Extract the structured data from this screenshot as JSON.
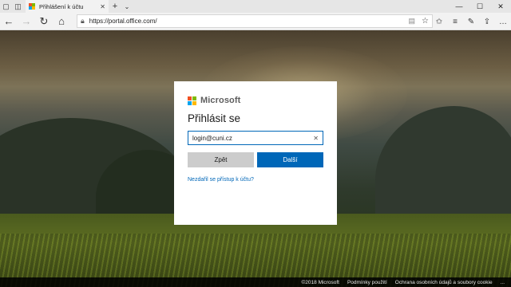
{
  "browser": {
    "tab_title": "Přihlášení k účtu",
    "tab_close": "✕",
    "new_tab": "+",
    "tab_menu": "⌄",
    "url": "https://portal.office.com/",
    "window_controls": {
      "minimize": "—",
      "maximize": "☐",
      "close": "✕"
    },
    "nav": {
      "back": "←",
      "forward": "→",
      "refresh": "↻",
      "home": "⌂"
    },
    "toolbar": {
      "favorites": "☆",
      "reading": "≡",
      "pen": "✎",
      "share": "⇪",
      "more": "…"
    }
  },
  "dialog": {
    "brand": "Microsoft",
    "title": "Přihlásit se",
    "email_value": "login@cuni.cz",
    "clear_glyph": "✕",
    "back_label": "Zpět",
    "next_label": "Další",
    "cant_access_link": "Nezdařil se přístup k účtu?"
  },
  "footer": {
    "copyright": "©2018 Microsoft",
    "terms": "Podmínky použití",
    "privacy": "Ochrana osobních údajů a soubory cookie",
    "more": "..."
  },
  "colors": {
    "ms_red": "#f25022",
    "ms_green": "#7fba00",
    "ms_blue": "#00a4ef",
    "ms_yellow": "#ffb900",
    "accent_blue": "#0067b8"
  }
}
